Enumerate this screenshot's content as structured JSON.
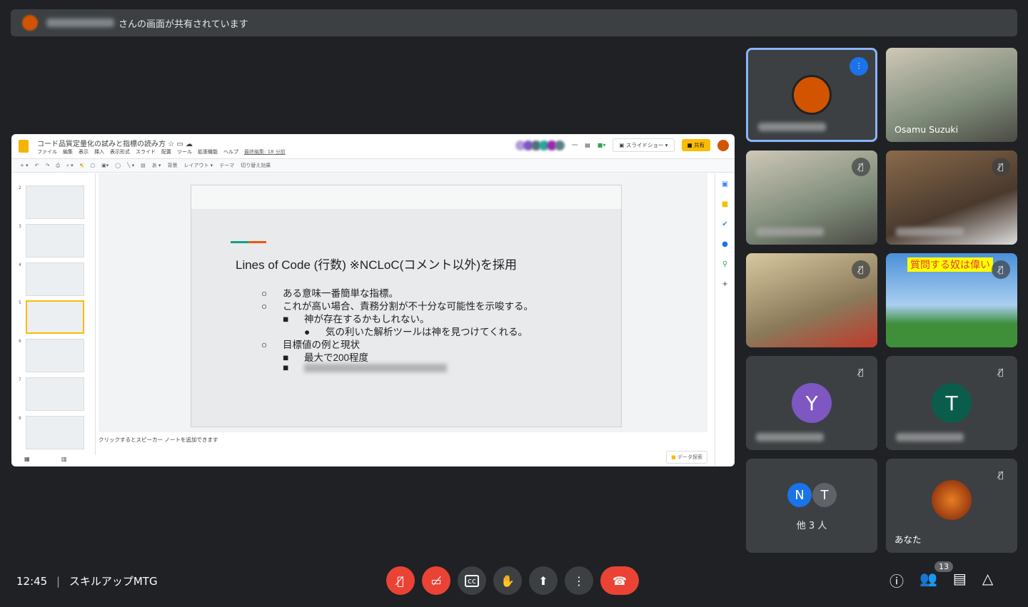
{
  "banner": {
    "suffix": "さんの画面が共有されています"
  },
  "slides_app": {
    "doc_title": "コード品質定量化の試みと指標の読み方",
    "menu": [
      "ファイル",
      "編集",
      "表示",
      "挿入",
      "表示形式",
      "スライド",
      "配置",
      "ツール",
      "拡張機能",
      "ヘルプ"
    ],
    "last_edit": "最終編集: 18 分前",
    "slideshow_label": "スライドショー",
    "share_label": "共有",
    "toolbar": [
      "背景",
      "レイアウト ▾",
      "テーマ",
      "切り替え効果"
    ],
    "thumb_numbers": [
      "2",
      "3",
      "4",
      "5",
      "6",
      "7",
      "8"
    ],
    "selected_slide": "5",
    "slide": {
      "title": "Lines of Code (行数) ※NCLoC(コメント以外)を採用",
      "bullets": [
        {
          "marker": "○",
          "level": 1,
          "text": "ある意味一番簡単な指標。"
        },
        {
          "marker": "○",
          "level": 1,
          "text": "これが高い場合、責務分割が不十分な可能性を示唆する。"
        },
        {
          "marker": "■",
          "level": 2,
          "text": "神が存在するかもしれない。"
        },
        {
          "marker": "●",
          "level": 3,
          "text": "気の利いた解析ツールは神を見つけてくれる。"
        },
        {
          "marker": "○",
          "level": 1,
          "text": "目標値の例と現状"
        },
        {
          "marker": "■",
          "level": 2,
          "text": "最大で200程度"
        },
        {
          "marker": "■",
          "level": 2,
          "text": ""
        }
      ]
    },
    "notes_placeholder": "クリックするとスピーカー ノートを追加できます",
    "explore_label": "データ探索"
  },
  "participants": [
    {
      "name": "",
      "state": "speaking"
    },
    {
      "name": "Osamu Suzuki",
      "state": "video"
    },
    {
      "name": "",
      "state": "muted"
    },
    {
      "name": "",
      "state": "muted"
    },
    {
      "name": "",
      "state": "muted"
    },
    {
      "name": "",
      "state": "muted",
      "overlay": "質問する奴は偉い"
    },
    {
      "name": "",
      "state": "muted",
      "initial": "Y",
      "color": "#7e57c2"
    },
    {
      "name": "",
      "state": "muted",
      "initial": "T",
      "color": "#0b5d4b"
    },
    {
      "name": "他 3 人",
      "initials": [
        "N",
        "T"
      ]
    },
    {
      "name": "あなた",
      "state": "muted"
    }
  ],
  "meeting": {
    "time": "12:45",
    "title": "スキルアップMTG",
    "people_count": "13"
  },
  "colors": {
    "background": "#202124",
    "end_call": "#ea4335",
    "active_border": "#8ab4f8",
    "share": "#fbbc04"
  }
}
